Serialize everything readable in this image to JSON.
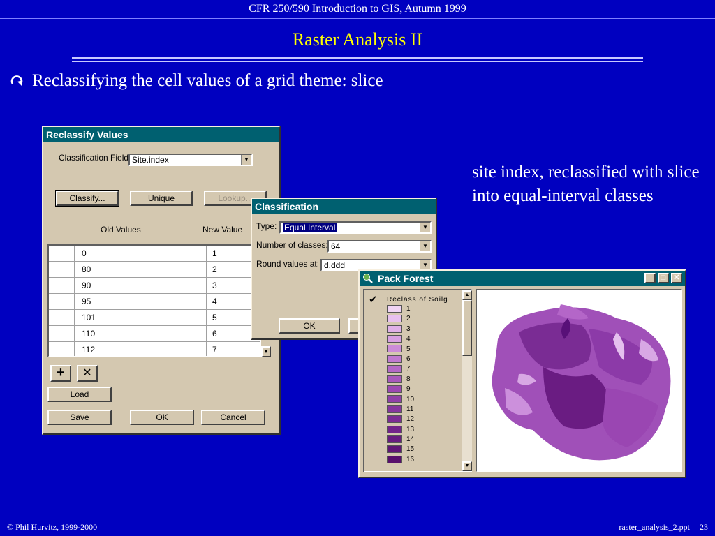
{
  "slide": {
    "course_title": "CFR 250/590 Introduction to GIS, Autumn 1999",
    "title": "Raster Analysis II",
    "bullet_icon": "curved-arrow-icon",
    "bullet_text": "Reclassifying the cell values of a grid theme: slice",
    "side_note": "site index, reclassified with slice into equal-interval classes",
    "footer_left": "© Phil Hurvitz, 1999-2000",
    "footer_file": "raster_analysis_2.ppt",
    "footer_page": "23",
    "background_color": "#0000c0",
    "title_color": "#ffff00"
  },
  "reclassify": {
    "title": "Reclassify Values",
    "field_label": "Classification Field:",
    "field_value": "Site.index",
    "classify_label": "Classify...",
    "unique_label": "Unique",
    "lookup_label": "Lookup...",
    "old_header": "Old Values",
    "new_header": "New Value",
    "rows": [
      {
        "old": "0",
        "new": "1"
      },
      {
        "old": "80",
        "new": "2"
      },
      {
        "old": "90",
        "new": "3"
      },
      {
        "old": "95",
        "new": "4"
      },
      {
        "old": "101",
        "new": "5"
      },
      {
        "old": "110",
        "new": "6"
      },
      {
        "old": "112",
        "new": "7"
      }
    ],
    "add_icon": "plus-icon",
    "remove_icon": "x-icon",
    "load_label": "Load",
    "save_label": "Save",
    "ok_label": "OK",
    "cancel_label": "Cancel"
  },
  "classification": {
    "title": "Classification",
    "type_label": "Type:",
    "type_value": "Equal Interval",
    "num_label": "Number of classes:",
    "num_value": "64",
    "round_label": "Round values at:",
    "round_value": "d.ddd",
    "ok_label": "OK"
  },
  "pack_forest": {
    "title": "Pack Forest",
    "app_icon": "globe-magnifier-icon",
    "legend_title": "Reclass of Soilg",
    "classes": [
      "1",
      "2",
      "3",
      "4",
      "5",
      "6",
      "7",
      "8",
      "9",
      "10",
      "11",
      "12",
      "13",
      "14",
      "15",
      "16"
    ],
    "class_colors": [
      "#f0d4f4",
      "#e8c0ee",
      "#e0b0e8",
      "#d8a0e2",
      "#cc8cd8",
      "#c07ad0",
      "#b468c6",
      "#a858bc",
      "#9c48b2",
      "#9040a8",
      "#86369e",
      "#7c2c94",
      "#72248a",
      "#681c80",
      "#601676",
      "#58106c"
    ]
  }
}
